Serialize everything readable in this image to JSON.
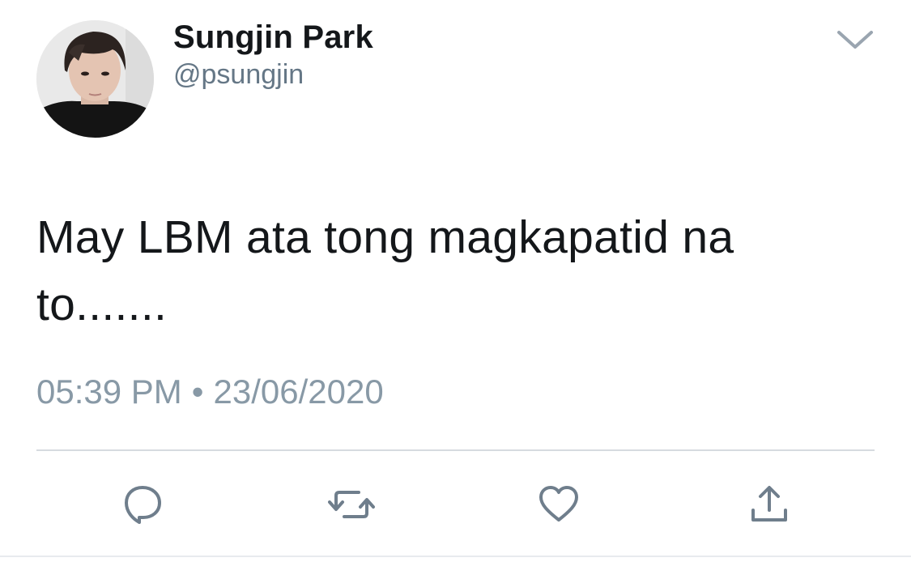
{
  "user": {
    "display_name": "Sungjin Park",
    "handle": "@psungjin"
  },
  "tweet": {
    "text": "May LBM ata tong magkapatid na to.......",
    "time": "05:39 PM",
    "separator": "•",
    "date": "23/06/2020"
  },
  "icons": {
    "menu": "chevron-down-icon",
    "reply": "reply-icon",
    "retweet": "retweet-icon",
    "like": "heart-icon",
    "share": "share-icon"
  },
  "colors": {
    "text": "#14171a",
    "secondary": "#657786",
    "meta": "#8899a6",
    "icon": "#6f7e8c",
    "divider": "#d6dbe0"
  }
}
